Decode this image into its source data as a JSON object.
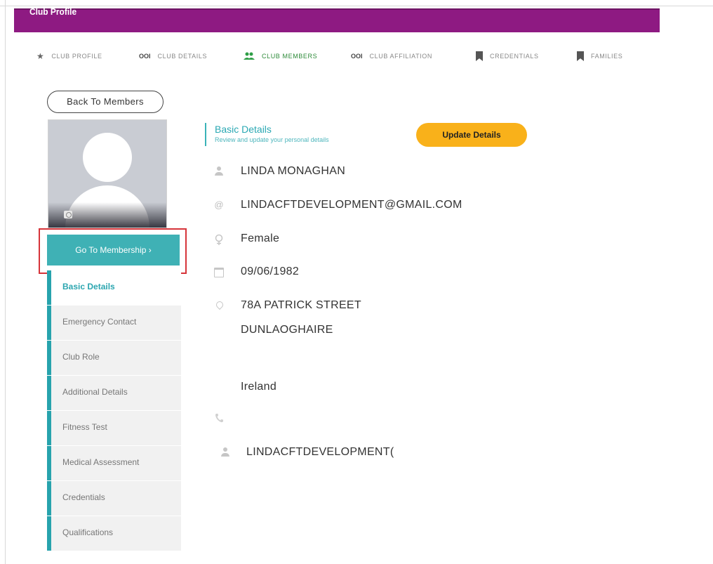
{
  "header": {
    "title": "Club Profile"
  },
  "tabs": [
    {
      "label": "CLUB PROFILE",
      "icon": "star-icon",
      "active": false
    },
    {
      "label": "CLUB DETAILS",
      "icon": "ooi-icon",
      "active": false
    },
    {
      "label": "CLUB MEMBERS",
      "icon": "members-icon",
      "active": true
    },
    {
      "label": "CLUB AFFILIATION",
      "icon": "ooi-icon",
      "active": false
    },
    {
      "label": "CREDENTIALS",
      "icon": "bookmark-icon",
      "active": false
    },
    {
      "label": "FAMILIES",
      "icon": "bookmark-icon",
      "active": false
    }
  ],
  "back_button": {
    "label": "Back To Members"
  },
  "go_membership": {
    "label": "Go To Membership ›"
  },
  "side_menu": [
    {
      "label": "Basic Details",
      "active": true
    },
    {
      "label": "Emergency Contact",
      "active": false
    },
    {
      "label": "Club Role",
      "active": false
    },
    {
      "label": "Additional Details",
      "active": false
    },
    {
      "label": "Fitness Test",
      "active": false
    },
    {
      "label": "Medical Assessment",
      "active": false
    },
    {
      "label": "Credentials",
      "active": false
    },
    {
      "label": "Qualifications",
      "active": false
    }
  ],
  "section": {
    "title": "Basic Details",
    "subtitle": "Review and update your personal details"
  },
  "update_button": {
    "label": "Update Details"
  },
  "details": {
    "name": "LINDA MONAGHAN",
    "email": "LINDACFTDEVELOPMENT@GMAIL.COM",
    "gender": "Female",
    "dob": "09/06/1982",
    "address_line1": "78A PATRICK STREET",
    "address_line2": "DUNLAOGHAIRE",
    "country": "Ireland",
    "phone": "",
    "username": "LINDACFTDEVELOPMENT("
  },
  "colors": {
    "header": "#8e1a82",
    "accent_teal": "#3fb1b5",
    "update_button": "#f9b11a",
    "highlight_border": "#d6343a",
    "active_tab": "#2e8b3a"
  }
}
